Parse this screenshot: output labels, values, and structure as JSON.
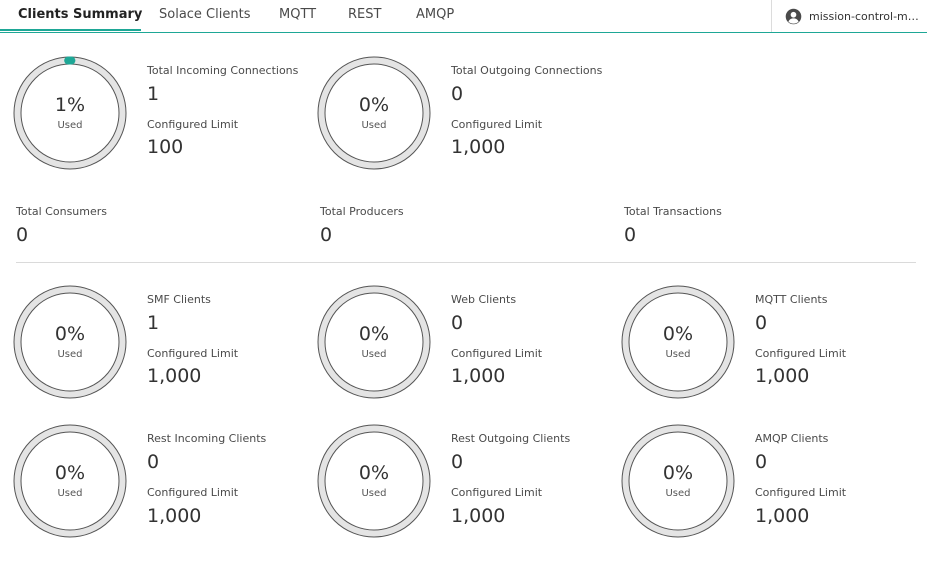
{
  "tabs": [
    {
      "label": "Clients Summary",
      "active": true
    },
    {
      "label": "Solace Clients",
      "active": false
    },
    {
      "label": "MQTT",
      "active": false
    },
    {
      "label": "REST",
      "active": false
    },
    {
      "label": "AMQP",
      "active": false
    }
  ],
  "user": {
    "name": "mission-control-manager",
    "icon": "user-circle-icon"
  },
  "colors": {
    "accent": "#1ea796",
    "ring_track": "#e4e4e4",
    "ring_fill": "#1ea796"
  },
  "connections": {
    "incoming": {
      "pct_label": "1%",
      "used_label": "Used",
      "used_fraction": 0.01,
      "title": "Total Incoming Connections",
      "value": "1",
      "limit_label": "Configured Limit",
      "limit": "100"
    },
    "outgoing": {
      "pct_label": "0%",
      "used_label": "Used",
      "used_fraction": 0,
      "title": "Total Outgoing Connections",
      "value": "0",
      "limit_label": "Configured Limit",
      "limit": "1,000"
    }
  },
  "totals": {
    "consumers": {
      "label": "Total Consumers",
      "value": "0"
    },
    "producers": {
      "label": "Total Producers",
      "value": "0"
    },
    "transactions": {
      "label": "Total Transactions",
      "value": "0"
    }
  },
  "clients": {
    "smf": {
      "pct_label": "0%",
      "used_label": "Used",
      "used_fraction": 0,
      "title": "SMF Clients",
      "value": "1",
      "limit_label": "Configured Limit",
      "limit": "1,000"
    },
    "web": {
      "pct_label": "0%",
      "used_label": "Used",
      "used_fraction": 0,
      "title": "Web Clients",
      "value": "0",
      "limit_label": "Configured Limit",
      "limit": "1,000"
    },
    "mqtt": {
      "pct_label": "0%",
      "used_label": "Used",
      "used_fraction": 0,
      "title": "MQTT Clients",
      "value": "0",
      "limit_label": "Configured Limit",
      "limit": "1,000"
    },
    "rest_in": {
      "pct_label": "0%",
      "used_label": "Used",
      "used_fraction": 0,
      "title": "Rest Incoming Clients",
      "value": "0",
      "limit_label": "Configured Limit",
      "limit": "1,000"
    },
    "rest_out": {
      "pct_label": "0%",
      "used_label": "Used",
      "used_fraction": 0,
      "title": "Rest Outgoing Clients",
      "value": "0",
      "limit_label": "Configured Limit",
      "limit": "1,000"
    },
    "amqp": {
      "pct_label": "0%",
      "used_label": "Used",
      "used_fraction": 0,
      "title": "AMQP Clients",
      "value": "0",
      "limit_label": "Configured Limit",
      "limit": "1,000"
    }
  }
}
